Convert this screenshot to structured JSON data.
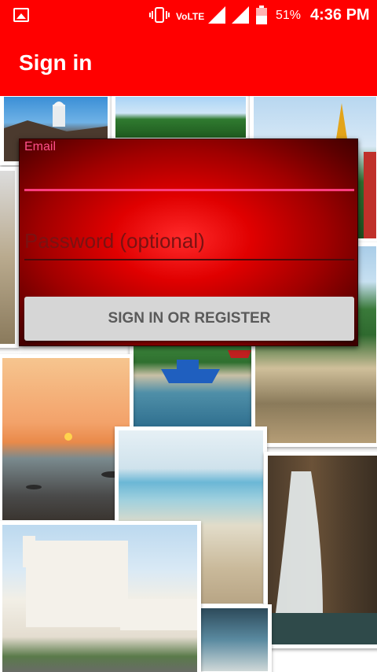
{
  "status_bar": {
    "volte": "VoLTE",
    "battery_percent": "51%",
    "time": "4:36 PM",
    "icons": [
      "gallery-icon",
      "vibrate-icon",
      "signal-icon",
      "battery-icon"
    ]
  },
  "app_bar": {
    "title": "Sign in"
  },
  "form": {
    "email_label": "Email",
    "email_value": "",
    "password_placeholder": "Password (optional)",
    "submit_label": "SIGN IN OR REGISTER"
  },
  "colors": {
    "primary": "#ff0000",
    "accent": "#ff3d7f",
    "button_bg": "#d6d6d6",
    "button_text": "#5a5a5a"
  },
  "collage": {
    "photos": [
      "fort-photo",
      "hill-fort-photo",
      "temple-photo",
      "church-photo",
      "fishing-boat-photo",
      "beach-photo",
      "sunset-photo",
      "shore-photo",
      "waterfall-photo",
      "cathedral-photo"
    ]
  }
}
